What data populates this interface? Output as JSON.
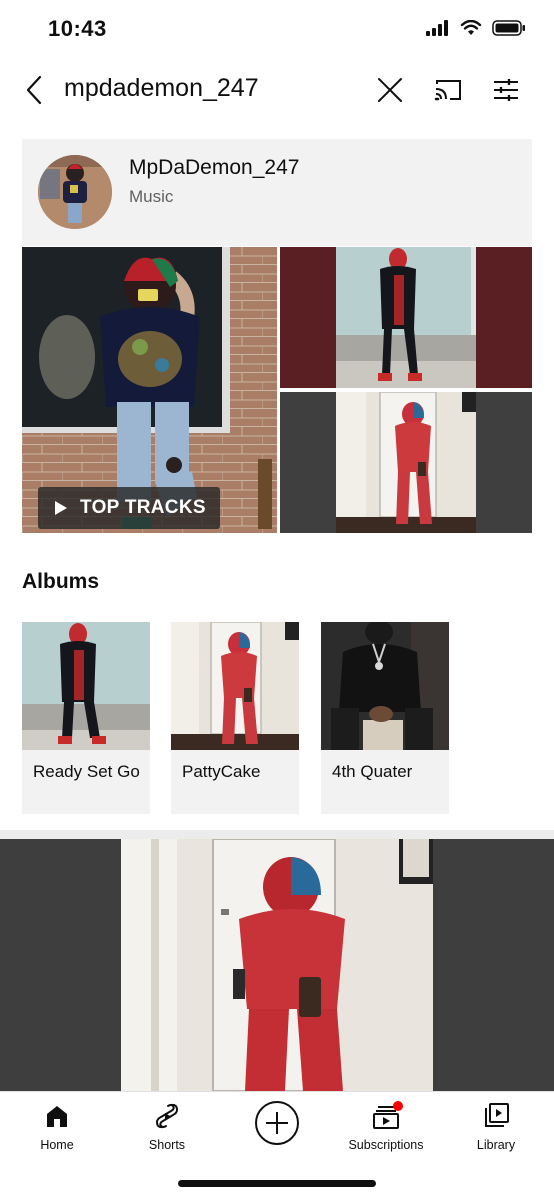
{
  "status_bar": {
    "time": "10:43"
  },
  "search": {
    "query": "mpdademon_247"
  },
  "artist": {
    "name": "MpDaDemon_247",
    "category": "Music"
  },
  "mosaic": {
    "top_tracks_label": "TOP TRACKS"
  },
  "albums": {
    "heading": "Albums",
    "items": [
      {
        "title": "Ready Set Go"
      },
      {
        "title": "PattyCake"
      },
      {
        "title": "4th Quater"
      }
    ]
  },
  "bottom_nav": {
    "items": [
      {
        "label": "Home",
        "icon": "home-icon"
      },
      {
        "label": "Shorts",
        "icon": "shorts-icon"
      },
      {
        "label": "Subscriptions",
        "icon": "subscriptions-icon"
      },
      {
        "label": "Library",
        "icon": "library-icon"
      }
    ],
    "create_icon": "create-plus-icon"
  },
  "colors": {
    "notification_dot": "#ff0000",
    "card_bg": "#f2f2f2",
    "video_bg": "#3e3e3e"
  }
}
